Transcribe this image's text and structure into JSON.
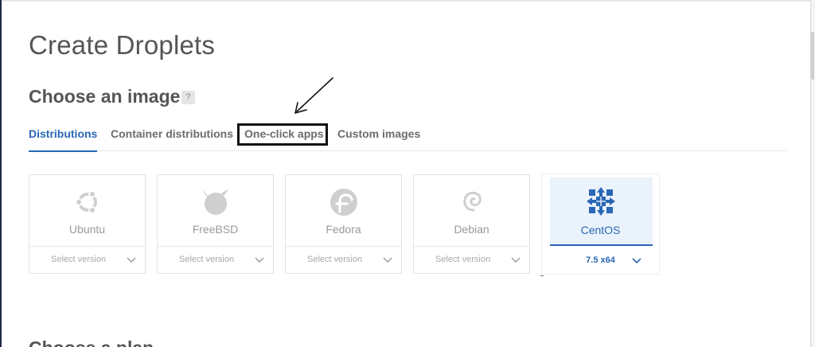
{
  "page": {
    "title": "Create Droplets"
  },
  "image_section": {
    "title": "Choose an image",
    "help": "?",
    "tabs": [
      {
        "label": "Distributions",
        "active": true
      },
      {
        "label": "Container distributions",
        "active": false
      },
      {
        "label": "One-click apps",
        "active": false,
        "highlighted": true
      },
      {
        "label": "Custom images",
        "active": false
      }
    ],
    "distros": [
      {
        "name": "Ubuntu",
        "version": "Select version",
        "icon": "ubuntu-icon",
        "selected": false
      },
      {
        "name": "FreeBSD",
        "version": "Select version",
        "icon": "freebsd-icon",
        "selected": false
      },
      {
        "name": "Fedora",
        "version": "Select version",
        "icon": "fedora-icon",
        "selected": false
      },
      {
        "name": "Debian",
        "version": "Select version",
        "icon": "debian-icon",
        "selected": false
      },
      {
        "name": "CentOS",
        "version": "7.5 x64",
        "icon": "centos-icon",
        "selected": true
      }
    ]
  },
  "plan_section": {
    "title": "Choose a plan"
  },
  "colors": {
    "accent": "#2a67b4",
    "muted": "#9a9a9a",
    "selected_bg": "#eaf2fb"
  }
}
